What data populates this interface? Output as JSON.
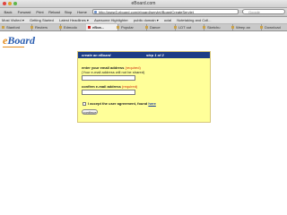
{
  "window": {
    "title": "eBoard.com"
  },
  "toolbar": {
    "back": "Back",
    "forward": "Forward",
    "print": "Print",
    "reload": "Reload",
    "stop": "Stop",
    "home": "Home",
    "url": "http://www3.eboard.com/eboard/servlet/BoardCreateServlet",
    "search_placeholder": "Google"
  },
  "bookmarks": [
    "Most Visited ▾",
    "Getting Started",
    "Latest Headlines ▾",
    "Awesome Highlighter",
    "public domain ▾",
    "ocial",
    "Notetaking and Coll..."
  ],
  "tabs": [
    "Stanford",
    "Reuters",
    "Edmodo",
    "eBoa...",
    "Popular",
    "Dance",
    "LDT out",
    "Sketchu",
    "Weep an",
    "Download"
  ],
  "active_tab_index": 3,
  "logo": {
    "first": "e",
    "rest": "Board"
  },
  "form": {
    "header_left": "create an eBoard",
    "header_right": "step 1 of 2",
    "email_label": "enter your email address",
    "email_required": "(required)",
    "email_note": "(Your e-mail address will not be shared)",
    "confirm_label": "confirm e-mail address",
    "confirm_required": "(required)",
    "agree_text": "I accept the user agreement, found",
    "agree_link": "here",
    "continue_label": "continue"
  },
  "colors": {
    "header_bg": "#1c3d86",
    "panel_bg": "#ffff99",
    "required": "#cc2a0a",
    "logo_blue": "#2a5db0",
    "logo_orange": "#e28a1a"
  }
}
